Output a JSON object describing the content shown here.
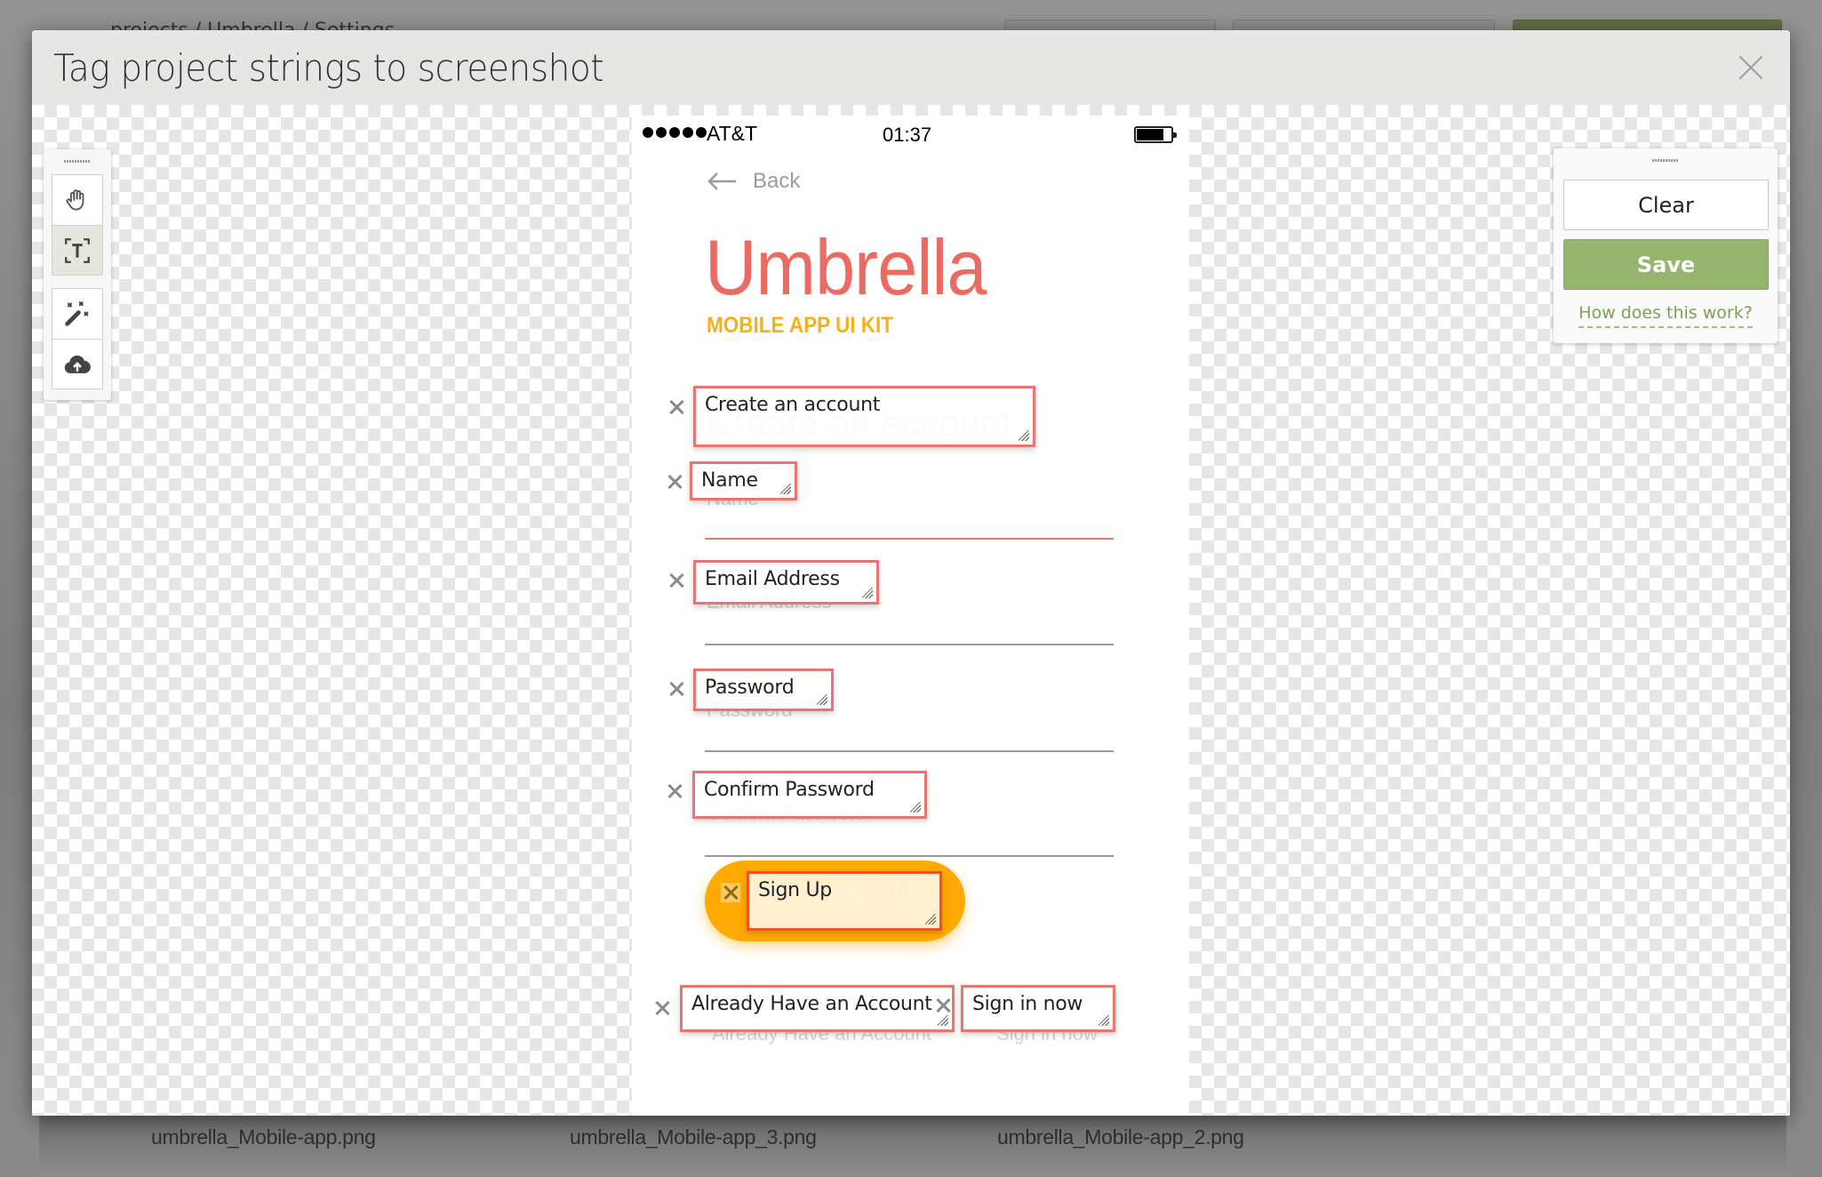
{
  "background": {
    "breadcrumb": "... projects / Umbrella / Settings",
    "files": [
      "umbrella_Mobile-app.png",
      "umbrella_Mobile-app_3.png",
      "umbrella_Mobile-app_2.png"
    ]
  },
  "modal": {
    "title": "Tag project strings to screenshot",
    "close_icon": "close-icon"
  },
  "toolbar": {
    "tools": [
      {
        "name": "pan",
        "icon": "hand-icon",
        "active": false
      },
      {
        "name": "text-select",
        "icon": "text-select-icon",
        "active": true
      },
      {
        "name": "auto-detect",
        "icon": "magic-wand-icon",
        "active": false
      },
      {
        "name": "upload",
        "icon": "cloud-upload-icon",
        "active": false
      }
    ]
  },
  "actions": {
    "clear_label": "Clear",
    "save_label": "Save",
    "help_link": "How does this work?",
    "save_color": "#97b46f"
  },
  "screenshot": {
    "status": {
      "carrier": "AT&T",
      "time": "01:37"
    },
    "back_label": "Back",
    "brand": "Umbrella",
    "brand_sub": "MOBILE APP UI KIT",
    "brand_color": "#ea6b62",
    "sub_color": "#f4b11c",
    "underlying_text": {
      "heading": "Create an account",
      "name": "Name",
      "email": "Email Address",
      "password": "Password",
      "confirm": "Confirm Password",
      "signup": "SIGN UP",
      "already": "Already Have an Account",
      "signin": "Sign in now"
    },
    "button_color": "#ffa903"
  },
  "tags": [
    {
      "id": "create-account",
      "text": "Create an account"
    },
    {
      "id": "name",
      "text": "Name"
    },
    {
      "id": "email",
      "text": "Email Address"
    },
    {
      "id": "password",
      "text": "Password"
    },
    {
      "id": "confirm-password",
      "text": "Confirm Password"
    },
    {
      "id": "sign-up",
      "text": "Sign Up"
    },
    {
      "id": "already-have-account",
      "text": "Already Have an Account"
    },
    {
      "id": "sign-in-now",
      "text": "Sign in now"
    }
  ],
  "tag_border_color": "#ea7474"
}
